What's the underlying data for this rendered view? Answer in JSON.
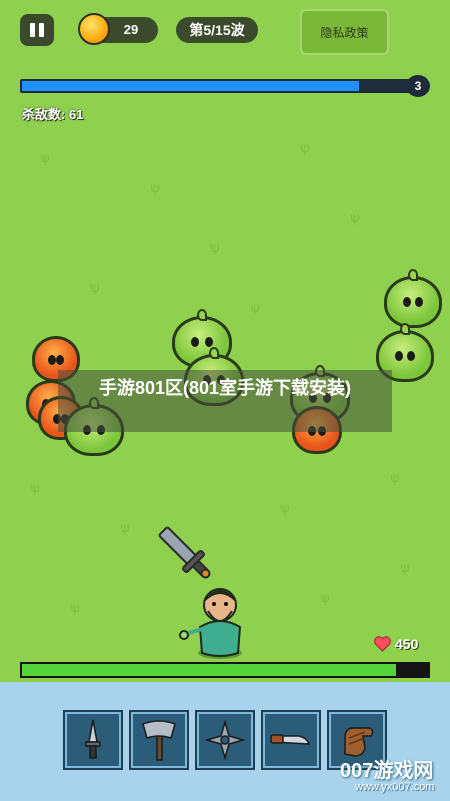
{
  "hud": {
    "coins": "29",
    "wave": "第5/15波",
    "privacy_label": "隐私政策",
    "wave_level": "3",
    "wave_progress": 0.85,
    "kills_label": "杀敌数:",
    "kills_value": "61"
  },
  "banner": {
    "text": "手游801区(801室手游下载安装)"
  },
  "player": {
    "hp_value": "450",
    "hp_fraction": 0.92
  },
  "weapons": [
    {
      "icon": "dagger-icon"
    },
    {
      "icon": "axe-icon"
    },
    {
      "icon": "shuriken-icon"
    },
    {
      "icon": "knife-icon"
    },
    {
      "icon": "glove-icon"
    }
  ],
  "watermark": {
    "main": "007游戏网",
    "sub": "www.yx007.com"
  },
  "colors": {
    "grass": "#8fd14f",
    "wave_bar": "#1e90ff",
    "hp_bar": "#55d43c",
    "panel": "#a9d3ea"
  }
}
